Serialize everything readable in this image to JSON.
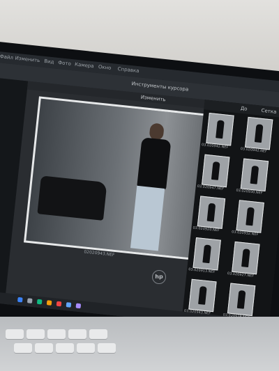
{
  "scene": {
    "alt_meaning": "photo-editing-laptop"
  },
  "app": {
    "menu_items": [
      "Файл",
      "Изменить",
      "Вид",
      "Фото",
      "Камера",
      "Окно",
      "Справка"
    ],
    "tool_label": "Инструменты курсора",
    "canvas_label": "Изменить",
    "caption": "02020943.NEF",
    "right_tabs": [
      "До",
      "Сетка"
    ]
  },
  "thumbnails": [
    {
      "label": "03.020942.NEF"
    },
    {
      "label": "03.020942.NEF"
    },
    {
      "label": "03.020947.NEF"
    },
    {
      "label": "03.020930.NEF"
    },
    {
      "label": "03.020920.NEF"
    },
    {
      "label": "03.020932.NEF"
    },
    {
      "label": "03.020913.NEF"
    },
    {
      "label": "03.020927.NEF"
    },
    {
      "label": "03.020943.NEF"
    },
    {
      "label": "03.020938.NEF"
    }
  ],
  "brand": {
    "logo": "hp"
  }
}
